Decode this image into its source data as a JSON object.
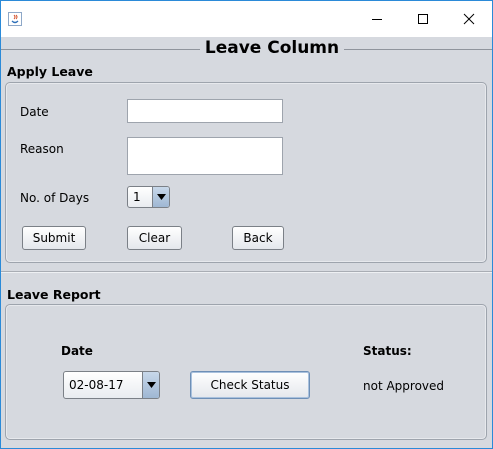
{
  "window": {
    "title": "",
    "minimize_icon": "minimize-icon",
    "maximize_icon": "maximize-icon",
    "close_icon": "close-icon"
  },
  "main": {
    "title": "Leave Column"
  },
  "apply_leave": {
    "section_title": "Apply Leave",
    "date_label": "Date",
    "date_value": "",
    "reason_label": "Reason",
    "reason_value": "",
    "days_label": "No. of Days",
    "days_selected": "1",
    "submit_label": "Submit",
    "clear_label": "Clear",
    "back_label": "Back"
  },
  "leave_report": {
    "section_title": "Leave Report",
    "date_label": "Date",
    "date_selected": "02-08-17",
    "check_status_label": "Check Status",
    "status_label": "Status:",
    "status_value": "not Approved"
  },
  "colors": {
    "window_border": "#2b8ad8",
    "background": "#d6d9df",
    "combo_arrow": "#9fb7d3"
  }
}
